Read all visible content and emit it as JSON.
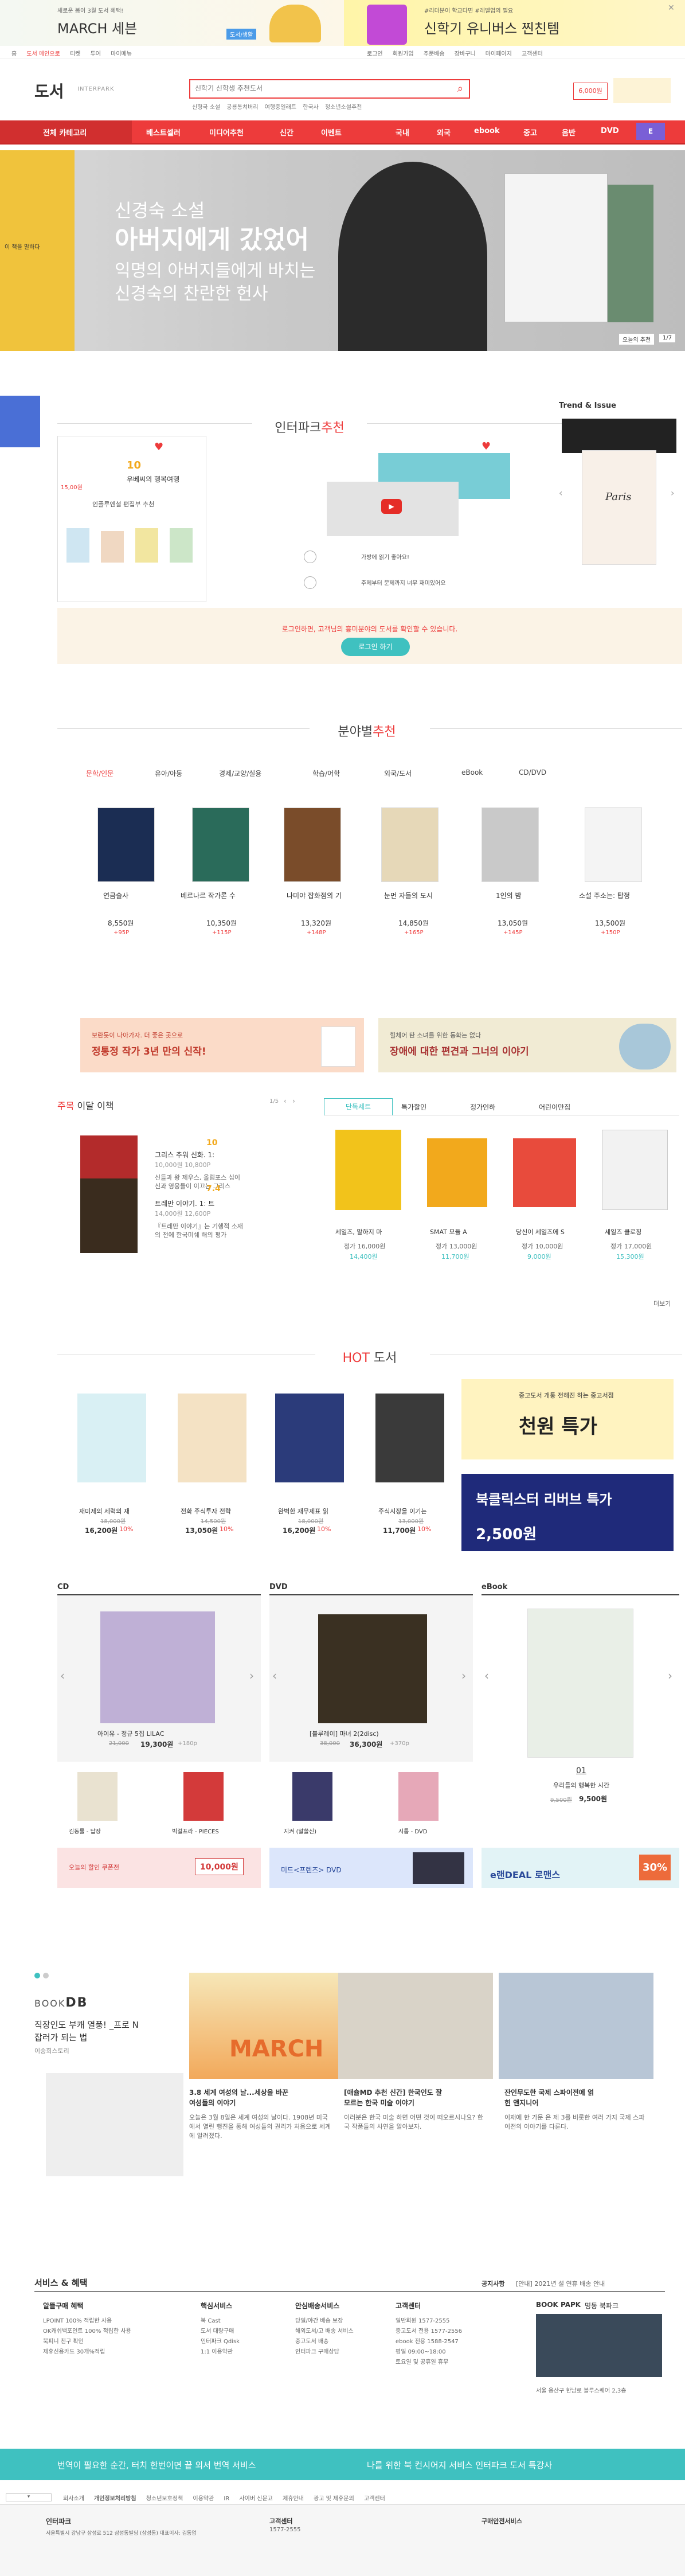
{
  "top_banner": {
    "left_sub": "새로운 봄이 3월 도서 혜택!",
    "left_title": "MARCH 세븐",
    "left_tag": "도서/생활",
    "right_sub": "#리더분이 학교다면 #레벨업의 필요",
    "right_title": "신학기 유니버스 찐친템"
  },
  "util": {
    "items": [
      "홈",
      "도서 메인으로",
      "티켓",
      "투어",
      "마이메뉴"
    ],
    "right": [
      "로그인",
      "회원가입",
      "주문배송",
      "장바구니",
      "마이페이지",
      "고객센터"
    ]
  },
  "logo": {
    "main": "도서",
    "sub": "INTERPARK"
  },
  "search": {
    "placeholder": "신학기 신학생 추천도서",
    "tags": [
      "신형국 소설",
      "공룡통쳐버리",
      "여행중일래트",
      "한국사",
      "청소년소설추천"
    ]
  },
  "ad_badge": "6,000원",
  "gnb": {
    "all": "전체 카테고리",
    "items": [
      "베스트셀러",
      "미디어추천",
      "신간",
      "이벤트",
      "국내",
      "외국",
      "ebook",
      "중고",
      "음반",
      "DVD"
    ],
    "logo": "E"
  },
  "hero": {
    "sub": "신경숙 소설",
    "title": "아버지에게 갔었어",
    "desc1": "익명의 아버지들에게 바치는",
    "desc2": "신경숙의 찬란한 헌사",
    "btn": "오늘의 추천",
    "count": "1/7",
    "side_label": "이 책을 말하다"
  },
  "recommend": {
    "title_plain": "인터파크",
    "title_red": "추천",
    "card1_title": "우베씨의 행복여행",
    "card1_num": "10",
    "card1_price": "15,00원",
    "card1_sub": "인플루엔셜 편집부 추천",
    "card2_caption1": "가방에 읽기 좋아요!",
    "card2_caption2": "주제부터 문제까지 너무 재미있어요",
    "login_msg": "로그인하면, 고객님의 흥미분야의 도서를 확인할 수 있습니다.",
    "login_btn": "로그인 하기"
  },
  "trend": {
    "title": "Trend & Issue",
    "book": "Paris"
  },
  "category": {
    "title_plain": "분야별",
    "title_red": "추천",
    "tabs": [
      "문학/인문",
      "유아/아동",
      "경제/교양/실용",
      "학습/어학",
      "외국/도서",
      "eBook",
      "CD/DVD"
    ],
    "books": [
      {
        "title": "연금술사",
        "price": "8,550원",
        "pt": "+95P"
      },
      {
        "title": "베르나르 작가론 수",
        "price": "10,350원",
        "pt": "+115P"
      },
      {
        "title": "나미야 잡화점의 기",
        "price": "13,320원",
        "pt": "+148P"
      },
      {
        "title": "눈먼 자들의 도시",
        "price": "14,850원",
        "pt": "+165P"
      },
      {
        "title": "1인의 밤",
        "price": "13,050원",
        "pt": "+145P"
      },
      {
        "title": "소설 주소는: 탑정",
        "price": "13,500원",
        "pt": "+150P"
      }
    ]
  },
  "promo": {
    "left_sub": "보란듯이 나아가자. 더 좋은 곳으로",
    "left_title": "정통정 작가 3년 만의 신작!",
    "right_sub": "힐체어 탄 소녀를 위한 동화는 없다",
    "right_title": "장애에 대한 편견과 그너의 이야기"
  },
  "monthly": {
    "title_red": "주목",
    "title_plain": "이달 이책",
    "page": "1/5",
    "items": [
      {
        "rating": "10",
        "title": "그리스 추워 신화. 1:",
        "price": "10,000원 10,800P",
        "desc1": "신들과 왕 제우스, 올림포스 십이",
        "desc2": "신과 영웅들이 이끄는 그리스"
      },
      {
        "rating": "7.4",
        "title": "트레만 이야기. 1: 트",
        "price": "14,000원 12,600P",
        "desc1": "『트레만 이야기』는 기행적 소재",
        "desc2": "의 전에 한국미쉐 해의 평가"
      }
    ]
  },
  "tabs2": {
    "items": [
      "단독세트",
      "특가할인",
      "정가인하",
      "어린이만집"
    ],
    "books": [
      {
        "title": "세일즈, 말하지 마",
        "price": "정가 16,000원",
        "sale": "14,400원"
      },
      {
        "title": "SMAT 모듈 A",
        "price": "정가 13,000원",
        "sale": "11,700원"
      },
      {
        "title": "당신이 세일즈에 S",
        "price": "정가 10,000원",
        "sale": "9,000원"
      },
      {
        "title": "세일즈 클로징",
        "price": "정가 17,000원",
        "sale": "15,300원"
      }
    ],
    "more": "더보기"
  },
  "hot": {
    "title_red": "HOT",
    "title_plain": "도서",
    "books": [
      {
        "title": "재미제의 세력의 재",
        "orig": "18,000원",
        "price": "16,200원",
        "pct": "10%"
      },
      {
        "title": "전화 주식투자 전략",
        "orig": "14,500원",
        "price": "13,050원",
        "pct": "10%"
      },
      {
        "title": "완벽한 재무제표 읽",
        "orig": "18,000원",
        "price": "16,200원",
        "pct": "10%"
      },
      {
        "title": "주식시장을 이기는",
        "orig": "13,000원",
        "price": "11,700원",
        "pct": "10%"
      }
    ],
    "ad1_sub": "중고도서 개통 전해진 하는 중고서점",
    "ad1_title": "천원 특가",
    "ad2_title": "북클릭스터 리버브 특가",
    "ad2_price": "2,500원"
  },
  "media": {
    "cd_title": "CD",
    "dvd_title": "DVD",
    "ebook_title": "eBook",
    "cd_main": "아이유 - 정규 5집 LILAC",
    "cd_price": "19,300원",
    "cd_orig": "21,000",
    "cd_pt": "+180p",
    "dvd_main": "[블루레이] 마녀 2(2disc)",
    "dvd_price": "36,300원",
    "dvd_orig": "38,000",
    "dvd_pt": "+370p",
    "cd_sub": [
      "김동률 - 답장",
      "빅걸프라 - PIECES"
    ],
    "dvd_sub": [
      "지켜 (알쓸신)",
      "시툼 - DVD"
    ],
    "ebook_num": "01",
    "ebook_title2": "우리들의 행복한 시간",
    "ebook_orig": "9,500원",
    "ebook_price": "9,500원",
    "ad_cd": "10,000원",
    "ad_cd_text": "오늘의 할인 쿠폰전",
    "ad_dvd_text": "미드<프렌즈> DVD",
    "ad_eb_pct": "30%",
    "ad_eb_text": "e랜DEAL 로맨스"
  },
  "bookdb": {
    "logo_main": "BOOK",
    "logo_db": "DB",
    "headline1": "직장인도 부캐 열풍! _프로 N",
    "headline2": "잡러가 되는 법",
    "author": "이승희스토리",
    "march": "MARCH",
    "articles": [
      {
        "title": "3.8 세계 여성의 날...세상을 바꾼",
        "sub": "여성들의 이야기",
        "body": "오늘은 3월 8일은 세계 여성의 날이다. 1908년 미국에서 열린 행진을 통해 여성들의 권리가 처음으로 세계에 알려졌다."
      },
      {
        "title": "[애슐MD 추천 신간] 한국인도 잘",
        "sub": "모르는 한국 미술 이야기",
        "body": "이러분은 한국 미술 하면 어떤 것이 떠오르시나요? 한국 작품들의 사연을 알아보자."
      },
      {
        "title": "잔인무도한 국제 스파이전에 얽",
        "sub": "힌 앤지니어",
        "body": "이재에 한 가문 은 제 3를 비롯한 여러 가지 국제 스파이전의 이야기를 다룬다."
      }
    ]
  },
  "service": {
    "title": "서비스 & 혜택",
    "notice_label": "공지사항",
    "notice": "[안내] 2021년 설 연휴 배송 안내",
    "cols": [
      {
        "h": "알뜰구매 혜택",
        "items": [
          "LPOINT 100% 적립한 사용",
          "OK캐쉬백포인트 100% 적립한 사용",
          "북피니 친구 확인",
          "제휴신용카드 30개%적립"
        ]
      },
      {
        "h": "핵심서비스",
        "items": [
          "북 Cast",
          "도서 대량구매",
          "인터파크 Qdisk",
          "1:1 이용약관"
        ]
      },
      {
        "h": "안심배송서비스",
        "items": [
          "당일/야간 배송 보장",
          "해외도서/고 배송 서비스",
          "중고도서 배송",
          "인터파크 구매상담"
        ]
      },
      {
        "h": "고객센터",
        "items": [
          "일반회원 1577-2555",
          "중고도서 전용 1577-2556",
          "ebook 전용 1588-2547",
          "평일 09:00~18:00",
          "토요일 및 공휴일 휴무"
        ]
      }
    ],
    "paper": "BOOK PAPK",
    "paper_sub": "명동 북파크",
    "paper_cap": "서울 용산구 한남로 블루스퀘어 2,3층"
  },
  "bottom_banner": {
    "left": "번역이 필요한 순간, 터치 한번이면 끝 외서 번역 서비스",
    "right": "나를 위한 북 컨시어지 서비스 인터파크 도서 특강사"
  },
  "footer": {
    "links": [
      "회사소개",
      "개인정보처리방침",
      "청소년보호정책",
      "이용약관",
      "IR",
      "사이버 신문고",
      "제휴안내",
      "광고 및 제휴문의",
      "고객센터"
    ],
    "company": "인터파크",
    "addr": "서울특별시 강남구 삼성로 512 삼성동빌딩 (삼성동) 대표이사: 김동업",
    "cs_title": "고객센터",
    "cs_phone": "1577-2555",
    "safe_title": "구매안전서비스"
  },
  "colors": {
    "brand_red": "#ed3b3b",
    "teal": "#3fc1c0",
    "dark": "#333333"
  }
}
